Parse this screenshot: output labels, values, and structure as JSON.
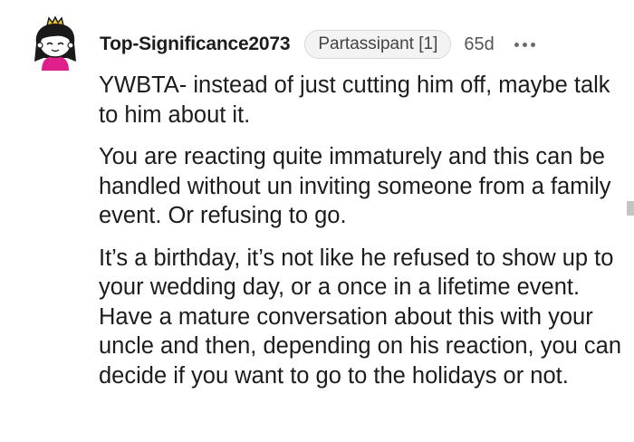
{
  "comment": {
    "username": "Top-Significance2073",
    "flair": "Partassipant [1]",
    "age": "65d",
    "paragraphs": [
      "YWBTA- instead of just cutting him off, maybe talk to him about it.",
      "You are reacting quite immaturely and this can be handled without un inviting someone from a family event. Or refusing to go.",
      "It’s a birthday, it’s not like he refused to show up to your wedding day, or a once in a lifetime event. Have a mature conversation about this with your uncle and then, depending on his reaction, you can decide if you want to go to the holidays or not."
    ]
  },
  "icons": {
    "avatar": "snoo-avatar-icon",
    "more": "more-options-icon"
  },
  "colors": {
    "text": "#1c1c1c",
    "flair_bg": "#f3f3f3",
    "avatar_hair": "#1a1a1a",
    "avatar_crown": "#f2c832",
    "avatar_shirt": "#e0208a"
  }
}
